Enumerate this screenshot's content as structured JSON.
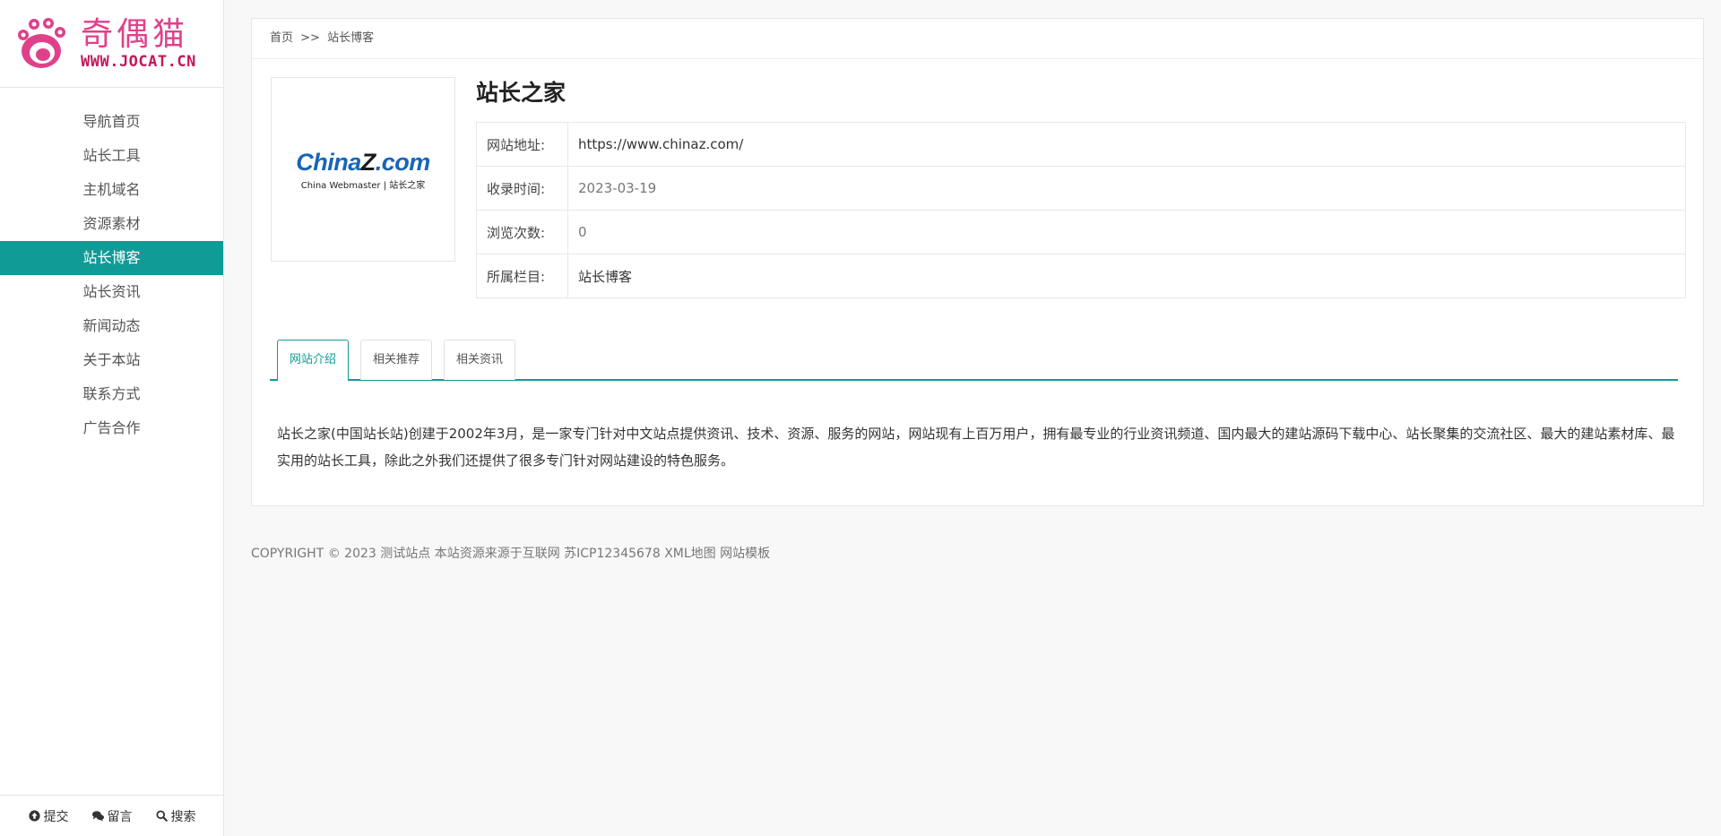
{
  "logo": {
    "cn_text": "奇偶猫",
    "url_text": "WWW.JOCAT.CN"
  },
  "nav": {
    "items": [
      {
        "label": "导航首页"
      },
      {
        "label": "站长工具"
      },
      {
        "label": "主机域名"
      },
      {
        "label": "资源素材"
      },
      {
        "label": "站长博客",
        "active": true
      },
      {
        "label": "站长资讯"
      },
      {
        "label": "新闻动态"
      },
      {
        "label": "关于本站"
      },
      {
        "label": "联系方式"
      },
      {
        "label": "广告合作"
      }
    ]
  },
  "sidebar_footer": {
    "submit": "提交",
    "message": "留言",
    "search": "搜索"
  },
  "breadcrumb": {
    "home": "首页",
    "sep": ">>",
    "current": "站长博客"
  },
  "site": {
    "logo_part1": "China",
    "logo_part2": "Z",
    "logo_part3": ".com",
    "logo_sub": "China Webmaster | 站长之家",
    "title": "站长之家",
    "fields": [
      {
        "key": "网站地址:",
        "value": "https://www.chinaz.com/"
      },
      {
        "key": "收录时间:",
        "value": "2023-03-19"
      },
      {
        "key": "浏览次数:",
        "value": "0"
      },
      {
        "key": "所属栏目:",
        "value": "站长博客"
      }
    ]
  },
  "tabs": [
    {
      "label": "网站介绍",
      "active": true
    },
    {
      "label": "相关推荐"
    },
    {
      "label": "相关资讯"
    }
  ],
  "description": "站长之家(中国站长站)创建于2002年3月，是一家专门针对中文站点提供资讯、技术、资源、服务的网站，网站现有上百万用户，拥有最专业的行业资讯频道、国内最大的建站源码下载中心、站长聚集的交流社区、最大的建站素材库、最实用的站长工具，除此之外我们还提供了很多专门针对网站建设的特色服务。",
  "footer": {
    "copyright": "COPYRIGHT © 2023 测试站点 本站资源来源于互联网 苏ICP12345678 XML地图 网站模板"
  },
  "colors": {
    "accent": "#109b96",
    "logo_pink": "#e0408a"
  }
}
